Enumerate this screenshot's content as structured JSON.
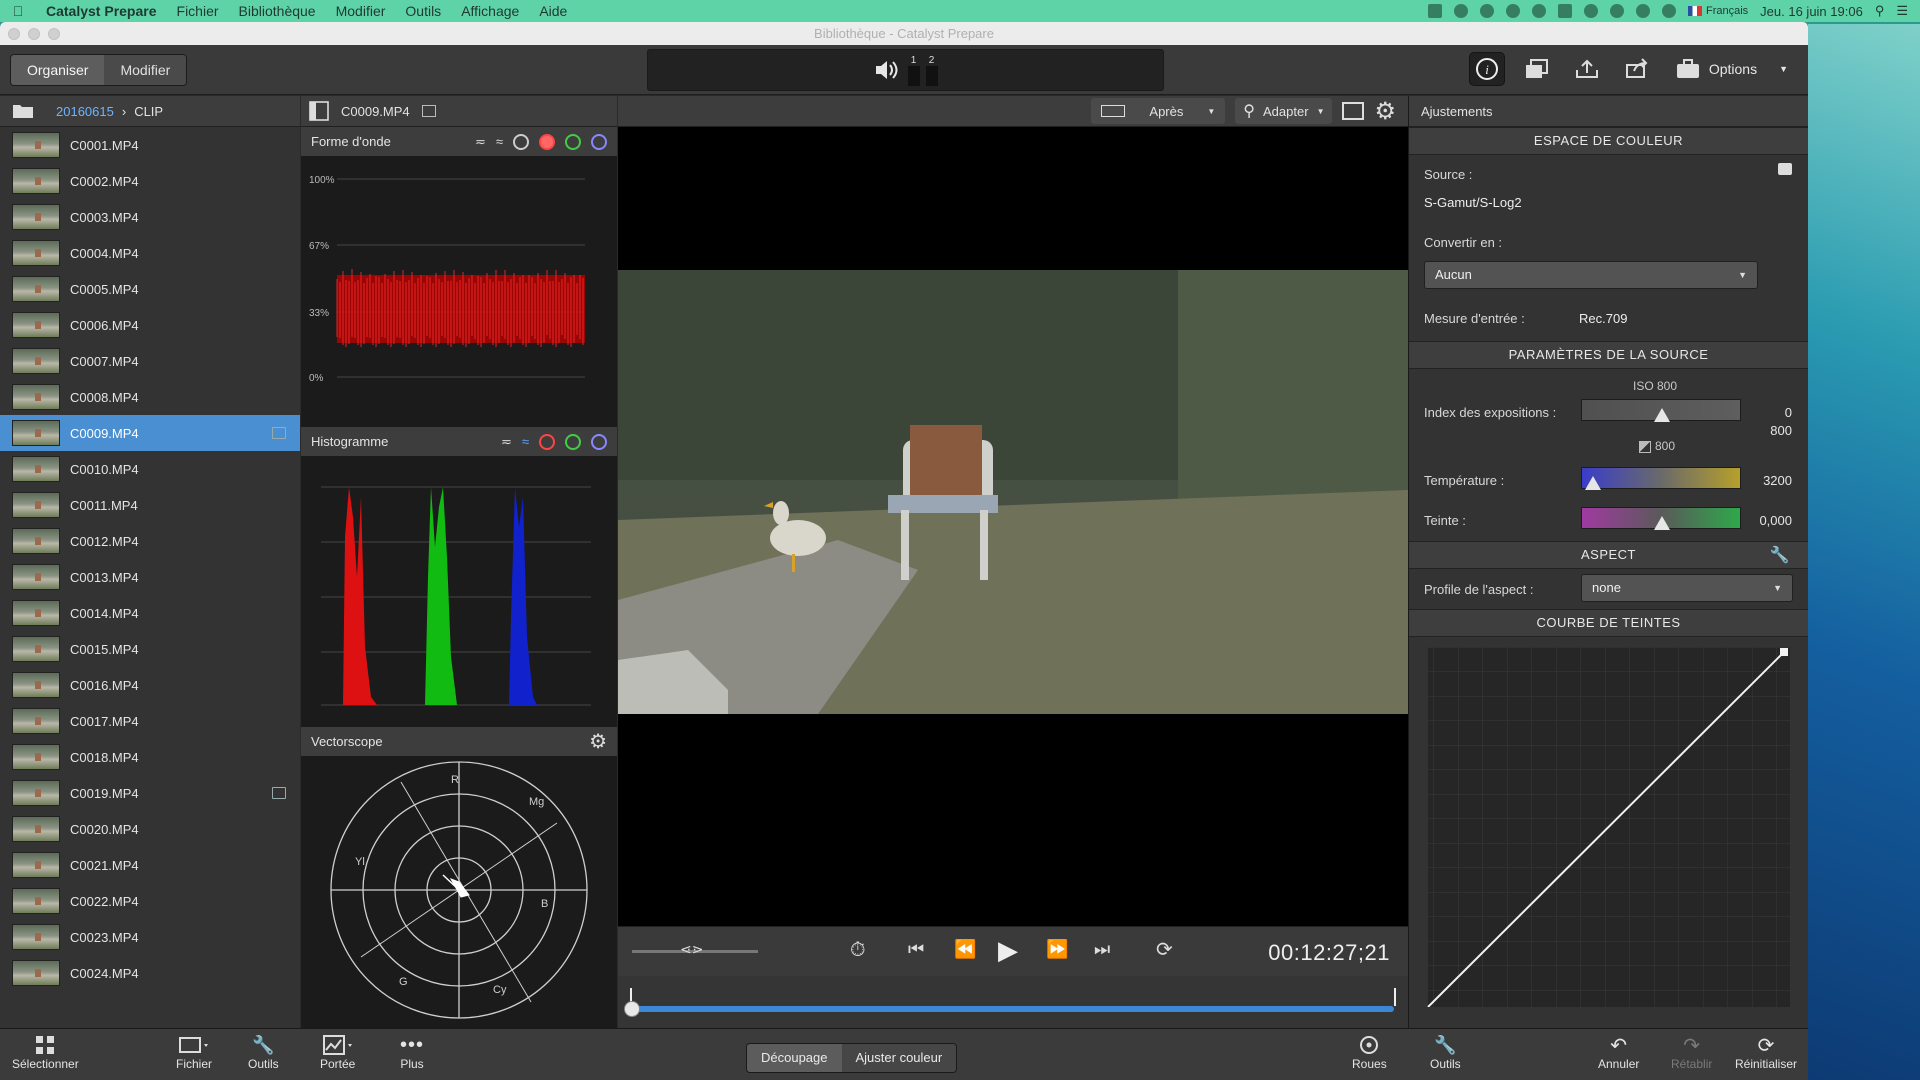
{
  "menubar": {
    "app_name": "Catalyst Prepare",
    "items": [
      "Fichier",
      "Bibliothèque",
      "Modifier",
      "Outils",
      "Affichage",
      "Aide"
    ],
    "input_source": "Français",
    "clock": "Jeu. 16 juin  19:06"
  },
  "window": {
    "title": "Bibliothèque - Catalyst Prepare"
  },
  "toolbar": {
    "mode_tabs": [
      "Organiser",
      "Modifier"
    ],
    "active_mode": "Organiser",
    "audio_channels": [
      "1",
      "2"
    ],
    "options_label": "Options"
  },
  "library": {
    "breadcrumb": [
      "20160615",
      "CLIP"
    ],
    "clips": [
      {
        "name": "C0001.MP4",
        "selected": false,
        "has_note": false
      },
      {
        "name": "C0002.MP4",
        "selected": false,
        "has_note": false
      },
      {
        "name": "C0003.MP4",
        "selected": false,
        "has_note": false
      },
      {
        "name": "C0004.MP4",
        "selected": false,
        "has_note": false
      },
      {
        "name": "C0005.MP4",
        "selected": false,
        "has_note": false
      },
      {
        "name": "C0006.MP4",
        "selected": false,
        "has_note": false
      },
      {
        "name": "C0007.MP4",
        "selected": false,
        "has_note": false
      },
      {
        "name": "C0008.MP4",
        "selected": false,
        "has_note": false
      },
      {
        "name": "C0009.MP4",
        "selected": true,
        "has_note": true
      },
      {
        "name": "C0010.MP4",
        "selected": false,
        "has_note": false
      },
      {
        "name": "C0011.MP4",
        "selected": false,
        "has_note": false
      },
      {
        "name": "C0012.MP4",
        "selected": false,
        "has_note": false
      },
      {
        "name": "C0013.MP4",
        "selected": false,
        "has_note": false
      },
      {
        "name": "C0014.MP4",
        "selected": false,
        "has_note": false
      },
      {
        "name": "C0015.MP4",
        "selected": false,
        "has_note": false
      },
      {
        "name": "C0016.MP4",
        "selected": false,
        "has_note": false
      },
      {
        "name": "C0017.MP4",
        "selected": false,
        "has_note": false
      },
      {
        "name": "C0018.MP4",
        "selected": false,
        "has_note": false
      },
      {
        "name": "C0019.MP4",
        "selected": false,
        "has_note": true
      },
      {
        "name": "C0020.MP4",
        "selected": false,
        "has_note": false
      },
      {
        "name": "C0021.MP4",
        "selected": false,
        "has_note": false
      },
      {
        "name": "C0022.MP4",
        "selected": false,
        "has_note": false
      },
      {
        "name": "C0023.MP4",
        "selected": false,
        "has_note": false
      },
      {
        "name": "C0024.MP4",
        "selected": false,
        "has_note": false
      }
    ]
  },
  "viewer_header": {
    "clip_name": "C0009.MP4",
    "compare_mode": "Après",
    "zoom_label": "Adapter"
  },
  "scopes": {
    "waveform": {
      "title": "Forme d'onde",
      "ticks": [
        "100%",
        "67%",
        "33%",
        "0%"
      ]
    },
    "histogram": {
      "title": "Histogramme"
    },
    "vectorscope": {
      "title": "Vectorscope",
      "targets": [
        "R",
        "Mg",
        "B",
        "Cy",
        "G",
        "Yl"
      ]
    }
  },
  "transport": {
    "timecode": "00:12:27;21",
    "playhead_fraction": 0.0
  },
  "adjustments": {
    "title": "Ajustements",
    "color_space": {
      "section": "ESPACE DE COULEUR",
      "source_label": "Source :",
      "source_value": "S-Gamut/S-Log2",
      "convert_label": "Convertir en :",
      "convert_value": "Aucun",
      "input_measure_label": "Mesure d'entrée :",
      "input_measure_value": "Rec.709"
    },
    "source_params": {
      "section": "PARAMÈTRES DE LA SOURCE",
      "iso_label": "ISO 800",
      "exposure_label": "Index des expositions :",
      "exposure_value": "0",
      "exposure_iso_value": "800",
      "exposure_sub": "800",
      "exposure_fraction": 0.5,
      "temperature_label": "Température :",
      "temperature_value": "3200",
      "temperature_fraction": 0.07,
      "tint_label": "Teinte :",
      "tint_value": "0,000",
      "tint_fraction": 0.5
    },
    "look": {
      "section": "ASPECT",
      "profile_label": "Profile de l'aspect :",
      "profile_value": "none"
    },
    "tone_curve": {
      "section": "COURBE DE TEINTES"
    }
  },
  "bottombar": {
    "select": "Sélectionner",
    "file": "Fichier",
    "tools": "Outils",
    "scope": "Portée",
    "more": "Plus",
    "mode_tabs": [
      "Découpage",
      "Ajuster couleur"
    ],
    "active_mode_tab": "Découpage",
    "wheels": "Roues",
    "tools_right": "Outils",
    "undo": "Annuler",
    "redo": "Rétablir",
    "reset": "Réinitialiser"
  },
  "colors": {
    "menubar": "#5fd3a8",
    "selection": "#4a8fd1",
    "accent_link": "#6fb3ff"
  }
}
